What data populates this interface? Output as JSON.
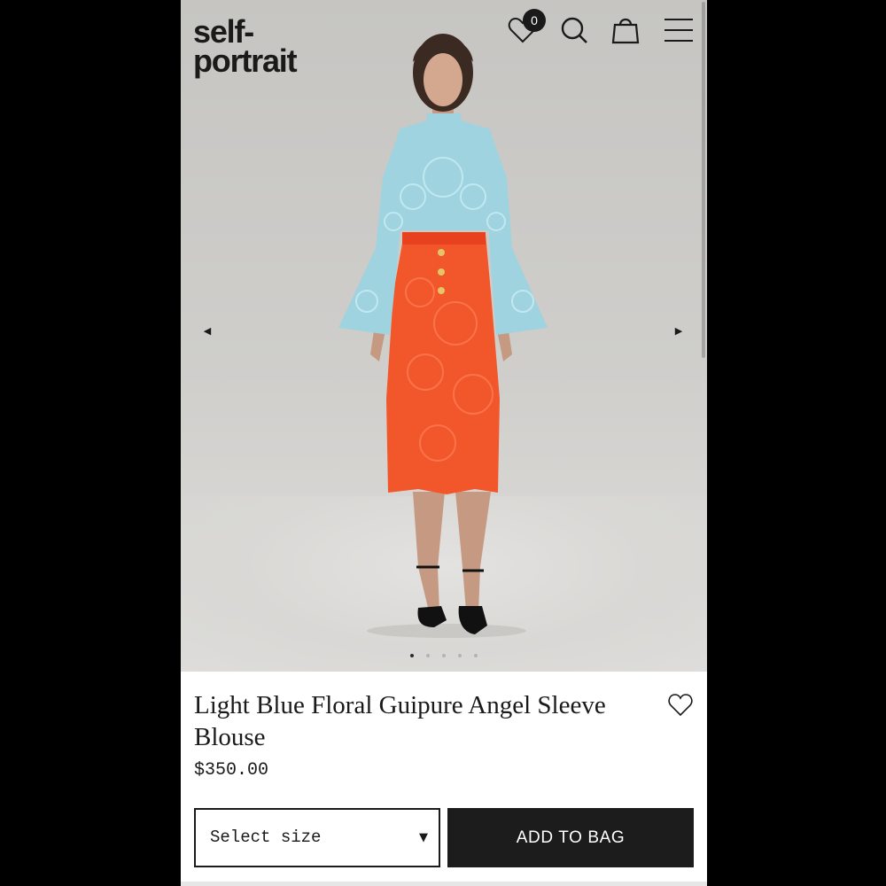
{
  "header": {
    "logo_line1": "self-",
    "logo_line2": "portrait",
    "wishlist_count": "0",
    "icons": [
      "heart-icon",
      "search-icon",
      "shopping-bag-icon",
      "menu-icon"
    ]
  },
  "gallery": {
    "prev_arrow": "◀",
    "next_arrow": "▶",
    "slide_count": 5,
    "active_slide": 1
  },
  "product": {
    "title": "Light Blue Floral Guipure Angel Sleeve Blouse",
    "price": "$350.00"
  },
  "purchase": {
    "size_placeholder": "Select size",
    "size_caret": "▼",
    "add_to_bag_label": "ADD TO BAG"
  },
  "colors": {
    "ink": "#1a1a1a",
    "button_bg": "#1c1c1c",
    "blouse": "#9fd3df",
    "skirt": "#f1572a"
  }
}
